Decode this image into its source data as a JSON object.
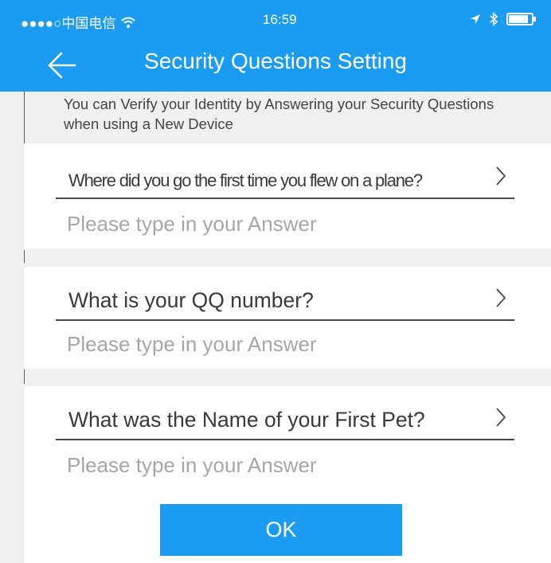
{
  "status_bar": {
    "carrier": "●●●●○中国电信",
    "time": "16:59",
    "wifi_icon": "wifi-icon",
    "location_icon": "location-arrow-icon",
    "bluetooth_icon": "bluetooth-icon",
    "battery_icon": "battery-icon",
    "battery_level": 0.8
  },
  "header": {
    "title": "Security Questions Setting",
    "back_icon": "back-arrow-icon"
  },
  "intro": {
    "text": "You can Verify your Identity by Answering your Security Questions when using a New Device"
  },
  "questions": [
    {
      "question": "Where did you go the first time you flew on a plane?",
      "answer": "",
      "placeholder": "Please type in your Answer"
    },
    {
      "question": "What is your QQ number?",
      "answer": "",
      "placeholder": "Please type in your Answer"
    },
    {
      "question": "What was the Name of your First Pet?",
      "answer": "",
      "placeholder": "Please type in your Answer"
    }
  ],
  "ok_button": {
    "label": "OK"
  },
  "colors": {
    "accent": "#1b9cf2",
    "background": "#f0f0f0",
    "card": "#ffffff",
    "placeholder": "#a6a6a6"
  }
}
